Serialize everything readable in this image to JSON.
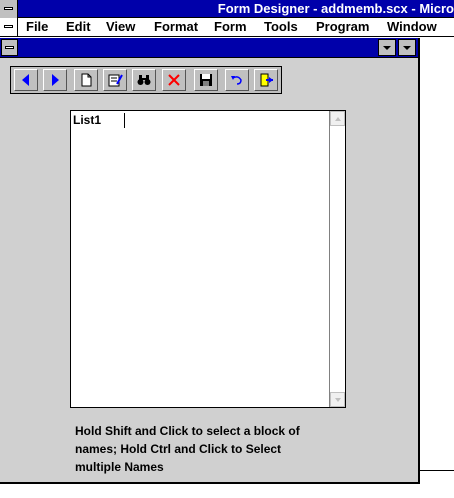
{
  "app": {
    "title": "Form Designer - addmemb.scx - Micro"
  },
  "menu": {
    "items": [
      "File",
      "Edit",
      "View",
      "Format",
      "Form",
      "Tools",
      "Program",
      "Window"
    ]
  },
  "toolbar": {
    "buttons": [
      {
        "icon": "triangle-left-icon",
        "color": "#0000ff"
      },
      {
        "icon": "triangle-right-icon",
        "color": "#0000ff"
      },
      {
        "icon": "new-page-icon"
      },
      {
        "icon": "edit-record-icon"
      },
      {
        "icon": "binoculars-icon"
      },
      {
        "icon": "delete-x-icon",
        "color": "#ff0000"
      },
      {
        "icon": "floppy-save-icon"
      },
      {
        "icon": "undo-arrow-icon",
        "color": "#0000ff"
      },
      {
        "icon": "exit-door-icon"
      }
    ]
  },
  "listbox": {
    "label": "List1"
  },
  "instruction": {
    "line1": "Hold Shift and Click to select a block of",
    "line2": "names;  Hold Ctrl and Click to Select",
    "line3": "multiple Names"
  }
}
